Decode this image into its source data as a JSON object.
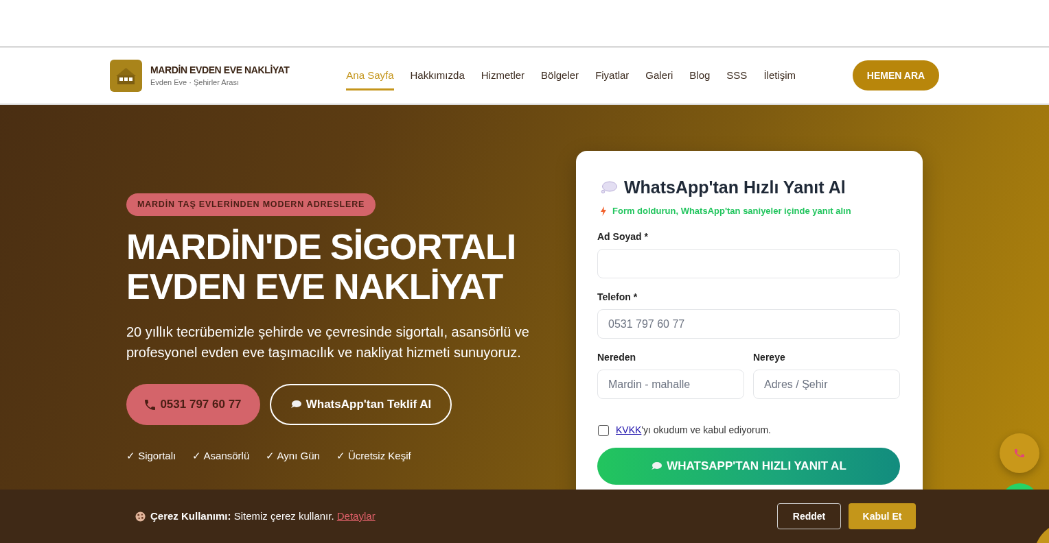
{
  "header": {
    "brand": {
      "name": "MARDİN EVDEN EVE NAKLİYAT",
      "tagline": "Evden Eve · Şehirler Arası"
    },
    "nav": [
      {
        "label": "Ana Sayfa",
        "selected": true
      },
      {
        "label": "Hakkımızda",
        "selected": false
      },
      {
        "label": "Hizmetler",
        "selected": false
      },
      {
        "label": "Bölgeler",
        "selected": false
      },
      {
        "label": "Fiyatlar",
        "selected": false
      },
      {
        "label": "Galeri",
        "selected": false
      },
      {
        "label": "Blog",
        "selected": false
      },
      {
        "label": "SSS",
        "selected": false
      },
      {
        "label": "İletişim",
        "selected": false
      }
    ],
    "cta_button": "HEMEN ARA"
  },
  "hero": {
    "badge": "MARDİN TAŞ EVLERİNDEN MODERN ADRESLERE",
    "title": "MARDİN'DE SİGORTALI EVDEN EVE NAKLİYAT",
    "description": "20 yıllık tecrübemizle şehirde ve çevresinde sigortalı, asansörlü ve profesyonel evden eve taşımacılık ve nakliyat hizmeti sunuyoruz.",
    "buttons": [
      {
        "kind": "phone",
        "label": "0531 797 60 77"
      },
      {
        "kind": "whatsapp",
        "label": "WhatsApp'tan Teklif Al"
      }
    ],
    "features": [
      "✓ Sigortalı",
      "✓ Asansörlü",
      "✓ Aynı Gün",
      "✓ Ücretsiz Keşif"
    ]
  },
  "quote_form": {
    "title": "WhatsApp'tan Hızlı Yanıt Al",
    "subtitle": "Form doldurun, WhatsApp'tan saniyeler içinde yanıt alın",
    "rows": [
      {
        "fields": [
          {
            "label": "Ad Soyad *"
          }
        ]
      },
      {
        "fields": [
          {
            "label": "Telefon *",
            "placeholder": "0531 797 60 77"
          }
        ]
      },
      {
        "fields": [
          {
            "label": "Nereden",
            "placeholder": "Mardin - mahalle"
          },
          {
            "label": "Nereye",
            "placeholder": "Adres / Şehir"
          }
        ]
      }
    ],
    "consent": {
      "checked": false,
      "link": "KVKK",
      "text": "'yı okudum ve kabul ediyorum."
    },
    "submit_button": "WHATSAPP'TAN HIZLI YANIT AL"
  },
  "cookie_bar": {
    "text": "**Çerez Kullanımı:** Sitemiz çerez kullanır.",
    "link": "Detaylar",
    "buttons": [
      {
        "kind": "reject",
        "label": "Reddet"
      },
      {
        "kind": "accept",
        "label": "Kabul Et"
      }
    ]
  }
}
